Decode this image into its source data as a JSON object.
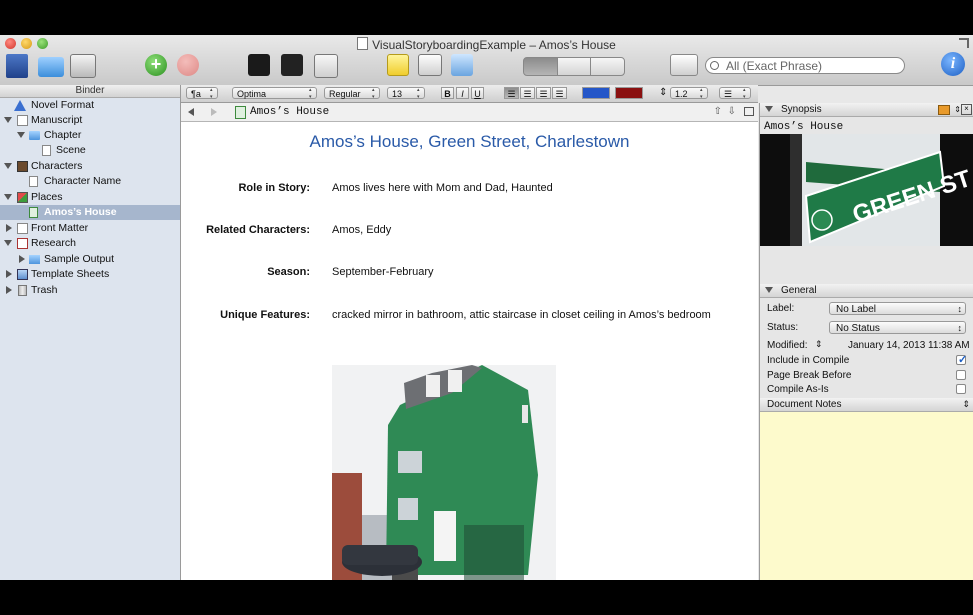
{
  "window": {
    "title": "VisualStoryboardingExample – Amos’s House"
  },
  "toolbar": {
    "search_placeholder": "All (Exact Phrase)",
    "info_label": "i"
  },
  "binder": {
    "title": "Binder",
    "items": [
      {
        "label": "Novel Format"
      },
      {
        "label": "Manuscript"
      },
      {
        "label": "Chapter"
      },
      {
        "label": "Scene"
      },
      {
        "label": "Characters"
      },
      {
        "label": "Character Name"
      },
      {
        "label": "Places"
      },
      {
        "label": "Amos’s House"
      },
      {
        "label": "Front Matter"
      },
      {
        "label": "Research"
      },
      {
        "label": "Sample Output"
      },
      {
        "label": "Template Sheets"
      },
      {
        "label": "Trash"
      }
    ]
  },
  "format_bar": {
    "style": "¶a",
    "font": "Optima",
    "weight": "Regular",
    "size": "13",
    "bold": "B",
    "italic": "I",
    "underline": "U",
    "line_spacing": "1.2",
    "text_color": "#2456c8",
    "highlight_color": "#8a1010"
  },
  "editor": {
    "header_title": "Amos’s House",
    "heading": "Amos’s House, Green Street, Charlestown",
    "fields": [
      {
        "label": "Role in Story:",
        "value": "Amos lives here with Mom and Dad, Haunted"
      },
      {
        "label": "Related Characters:",
        "value": "Amos, Eddy"
      },
      {
        "label": "Season:",
        "value": "September-February"
      },
      {
        "label": "Unique Features:",
        "value": "cracked mirror in bathroom, attic staircase in closet ceiling in Amos’s bedroom"
      }
    ]
  },
  "inspector": {
    "synopsis_header": "Synopsis",
    "synopsis_title": "Amos’s House",
    "sign_text": "GREEN ST",
    "general_header": "General",
    "label_label": "Label:",
    "label_value": "No Label",
    "status_label": "Status:",
    "status_value": "No Status",
    "modified_label": "Modified:",
    "modified_value": "January 14, 2013 11:38 AM",
    "include_in_compile": {
      "label": "Include in Compile",
      "checked": true
    },
    "page_break_before": {
      "label": "Page Break Before",
      "checked": false
    },
    "compile_as_is": {
      "label": "Compile As-Is",
      "checked": false
    },
    "notes_header": "Document Notes"
  },
  "colors": {
    "heading_blue": "#2a5aa8",
    "binder_bg": "#dde4ee",
    "binder_selection": "#a6b6cd",
    "notes_bg": "#fdfacc",
    "house_green": "#2f8a55"
  }
}
